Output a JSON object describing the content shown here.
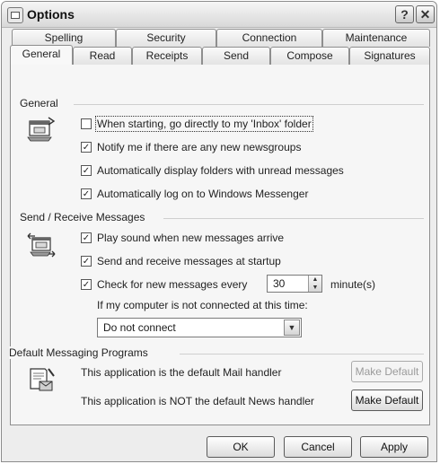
{
  "window": {
    "title": "Options"
  },
  "tabs_back": [
    "Spelling",
    "Security",
    "Connection",
    "Maintenance"
  ],
  "tabs_front": [
    "General",
    "Read",
    "Receipts",
    "Send",
    "Compose",
    "Signatures"
  ],
  "active_tab": "General",
  "general": {
    "label": "General",
    "options": [
      {
        "label": "When starting, go directly to my 'Inbox' folder",
        "checked": false
      },
      {
        "label": "Notify me if there are any new newsgroups",
        "checked": true
      },
      {
        "label": "Automatically display folders with unread messages",
        "checked": true
      },
      {
        "label": "Automatically log on to Windows Messenger",
        "checked": true
      }
    ]
  },
  "send_receive": {
    "label": "Send / Receive Messages",
    "options": [
      {
        "label": "Play sound when new messages arrive",
        "checked": true
      },
      {
        "label": "Send and receive messages at startup",
        "checked": true
      }
    ],
    "check_label": "Check for new messages every",
    "check_checked": true,
    "interval_value": "30",
    "interval_unit": "minute(s)",
    "not_connected_label": "If my computer is not connected at this time:",
    "connect_option": "Do not connect"
  },
  "default_programs": {
    "label": "Default Messaging Programs",
    "mail_text": "This application is the default Mail handler",
    "mail_button": "Make Default",
    "news_text": "This application is NOT the default News handler",
    "news_button": "Make Default"
  },
  "footer": {
    "ok": "OK",
    "cancel": "Cancel",
    "apply": "Apply"
  },
  "icons": {
    "general_group": "mail-window-icon",
    "send_receive_group": "send-receive-icon",
    "default_programs_group": "mail-handler-icon"
  }
}
